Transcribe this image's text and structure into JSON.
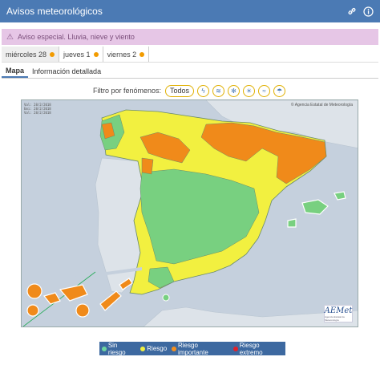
{
  "header": {
    "title": "Avisos meteorológicos",
    "link_icon": "link-icon",
    "info_icon": "info-icon"
  },
  "alert": {
    "text": "Aviso especial. Lluvia, nieve y viento",
    "icon": "warning-icon"
  },
  "day_tabs": [
    {
      "label": "miércoles 28",
      "color": "#f29b00"
    },
    {
      "label": "jueves 1",
      "color": "#f29b00"
    },
    {
      "label": "viernes 2",
      "color": "#f29b00"
    }
  ],
  "view_tabs": [
    "Mapa",
    "Información detallada"
  ],
  "filter": {
    "label": "Filtro por fenómenos:",
    "all": "Todos",
    "icons": [
      "thunderstorm-icon",
      "wind-icon",
      "snow-icon",
      "heat-icon",
      "coastal-icon",
      "rain-icon"
    ]
  },
  "map": {
    "stamp": [
      "Val: 28/2/2018",
      "Emi: 28/2/2018",
      "Val: 28/2/2018"
    ],
    "credit": "© Agencia Estatal de Meteorología",
    "logo": "AEMet",
    "logo_sub": "Agencia Estatal de Meteorología"
  },
  "legend": [
    {
      "label": "Sin riesgo",
      "color": "#6ed6a0"
    },
    {
      "label": "Riesgo",
      "color": "#f0f040"
    },
    {
      "label": "Riesgo importante",
      "color": "#f5901e"
    },
    {
      "label": "Riesgo extremo",
      "color": "#e0202a"
    }
  ],
  "colors": {
    "accent": "#4b7ab4",
    "sea": "#c5d0dd",
    "land_out": "#dde3e9",
    "yellow": "#f2f040",
    "orange": "#f08a1a",
    "green": "#78d080"
  }
}
